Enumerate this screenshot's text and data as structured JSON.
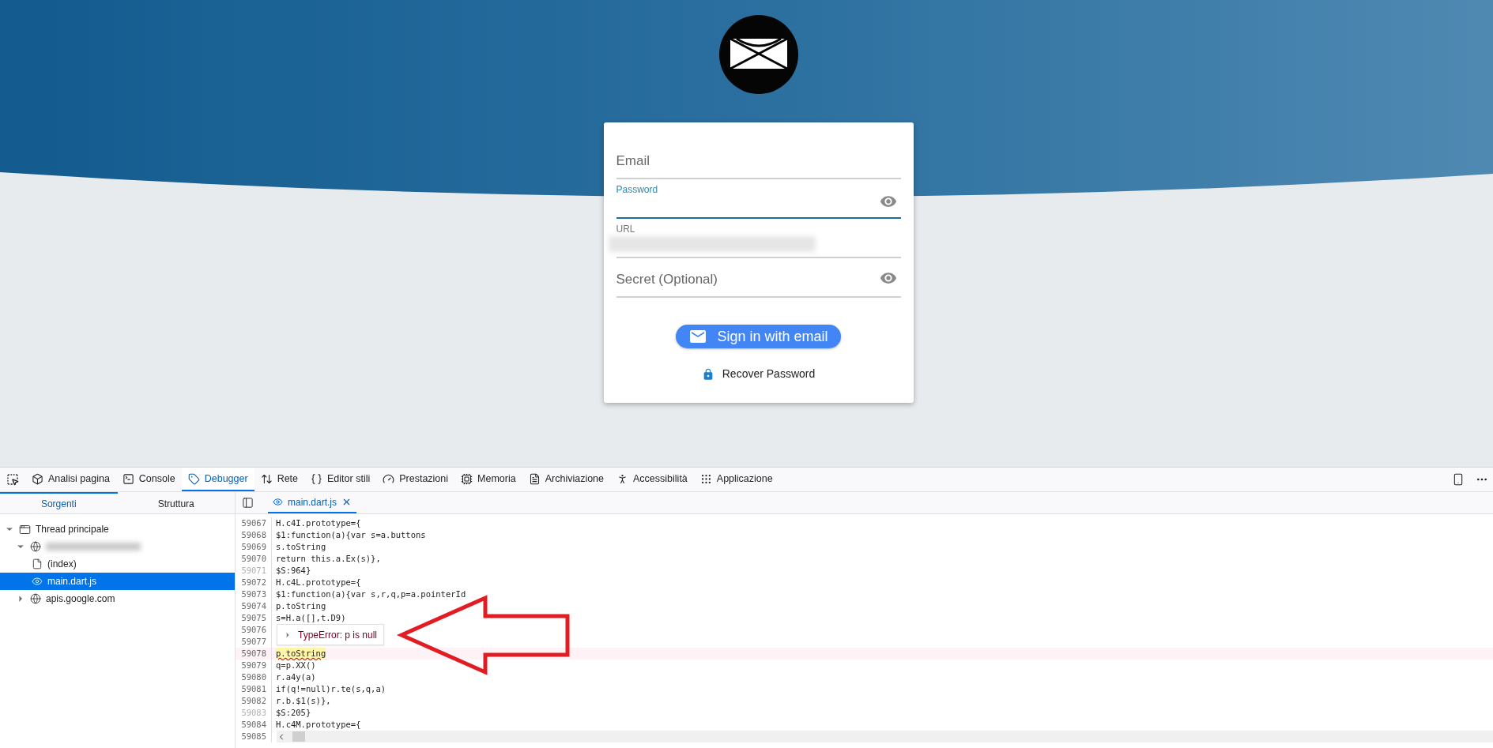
{
  "page": {
    "fields": [
      {
        "label": "Email",
        "focused": false,
        "floating": false,
        "redacted": false,
        "toggle": false
      },
      {
        "label": "Password",
        "focused": true,
        "floating": true,
        "redacted": false,
        "toggle": true
      },
      {
        "label": "URL",
        "focused": false,
        "floating": true,
        "redacted": true,
        "toggle": false
      },
      {
        "label": "Secret (Optional)",
        "focused": false,
        "floating": false,
        "redacted": false,
        "toggle": true
      }
    ],
    "sign_in_button": "Sign in with email",
    "recover_link": "Recover Password"
  },
  "devtools": {
    "tabs": [
      {
        "label": "Analisi pagina",
        "selected": false
      },
      {
        "label": "Console",
        "selected": false
      },
      {
        "label": "Debugger",
        "selected": true
      },
      {
        "label": "Rete",
        "selected": false
      },
      {
        "label": "Editor stili",
        "selected": false
      },
      {
        "label": "Prestazioni",
        "selected": false
      },
      {
        "label": "Memoria",
        "selected": false
      },
      {
        "label": "Archiviazione",
        "selected": false
      },
      {
        "label": "Accessibilità",
        "selected": false
      },
      {
        "label": "Applicazione",
        "selected": false
      }
    ],
    "side_tabs": [
      {
        "label": "Sorgenti",
        "selected": true
      },
      {
        "label": "Struttura",
        "selected": false
      }
    ],
    "tree": [
      {
        "kind": "thread",
        "label": "Thread principale",
        "expanded": true,
        "selected": false,
        "children": [
          {
            "kind": "domain",
            "redacted": true,
            "expanded": true,
            "selected": false,
            "children": [
              {
                "kind": "file",
                "label": "(index)",
                "selected": false
              },
              {
                "kind": "script",
                "label": "main.dart.js",
                "selected": true
              }
            ]
          },
          {
            "kind": "domain",
            "label": "apis.google.com",
            "redacted": false,
            "expanded": false,
            "selected": false
          }
        ]
      }
    ],
    "editor_tab": "main.dart.js",
    "code_lines": [
      {
        "number": "59067",
        "code": "H.c4I.prototype={",
        "dimmed": false,
        "error": false
      },
      {
        "number": "59068",
        "code": "$1:function(a){var s=a.buttons",
        "dimmed": false,
        "error": false
      },
      {
        "number": "59069",
        "code": "s.toString",
        "dimmed": false,
        "error": false
      },
      {
        "number": "59070",
        "code": "return this.a.Ex(s)},",
        "dimmed": false,
        "error": false
      },
      {
        "number": "59071",
        "code": "$S:964}",
        "dimmed": true,
        "error": false
      },
      {
        "number": "59072",
        "code": "H.c4L.prototype={",
        "dimmed": false,
        "error": false
      },
      {
        "number": "59073",
        "code": "$1:function(a){var s,r,q,p=a.pointerId",
        "dimmed": false,
        "error": false
      },
      {
        "number": "59074",
        "code": "p.toString",
        "dimmed": false,
        "error": false
      },
      {
        "number": "59075",
        "code": "s=H.a([],t.D9)",
        "dimmed": false,
        "error": false
      },
      {
        "number": "59076",
        "dimmed": false,
        "error": false
      },
      {
        "number": "59077",
        "dimmed": false,
        "error": false
      },
      {
        "number": "59078",
        "code": "p.toString",
        "dimmed": false,
        "error": true
      },
      {
        "number": "59079",
        "code": "q=p.XX()",
        "dimmed": false,
        "error": false
      },
      {
        "number": "59080",
        "code": "r.a4y(a)",
        "dimmed": false,
        "error": false
      },
      {
        "number": "59081",
        "code": "if(q!=null)r.te(s,q,a)",
        "dimmed": false,
        "error": false
      },
      {
        "number": "59082",
        "code": "r.b.$1(s)},",
        "dimmed": false,
        "error": false
      },
      {
        "number": "59083",
        "code": "$S:205}",
        "dimmed": true,
        "error": false
      },
      {
        "number": "59084",
        "code": "H.c4M.prototype={",
        "dimmed": false,
        "error": false
      },
      {
        "number": "59085",
        "dimmed": false,
        "error": false
      }
    ],
    "error_popup": "TypeError: p is null"
  }
}
